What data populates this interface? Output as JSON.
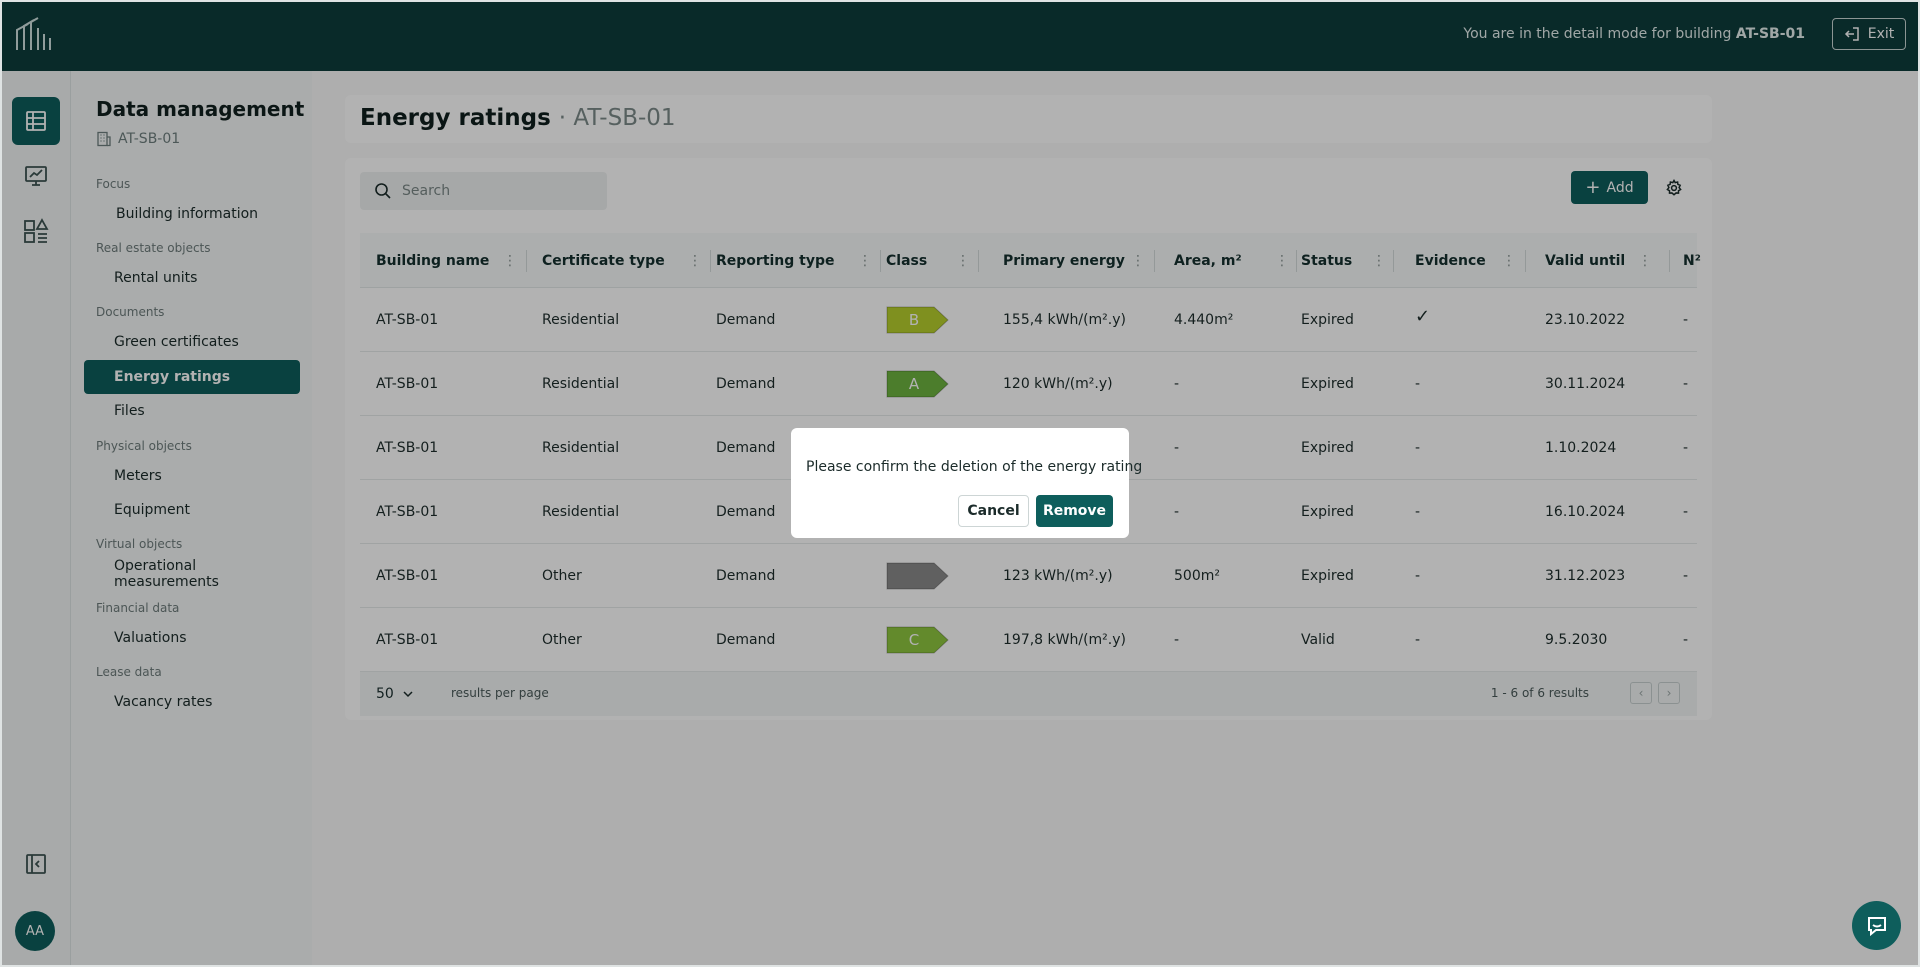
{
  "topbar": {
    "mode_prefix": "You are in the detail mode for building",
    "building": "AT-SB-01",
    "exit_label": "Exit"
  },
  "rail": {
    "items": [
      "table-icon",
      "monitor-chart-icon",
      "widgets-icon"
    ],
    "collapse_icon": "sidebar-collapse-icon",
    "avatar_initials": "AA"
  },
  "sidenav": {
    "title": "Data management",
    "building": "AT-SB-01",
    "sections": [
      {
        "label": "Focus",
        "items": [
          "Building information"
        ]
      },
      {
        "label": "Real estate objects",
        "items": [
          "Rental units"
        ]
      },
      {
        "label": "Documents",
        "items": [
          "Green certificates",
          "Energy ratings",
          "Files"
        ]
      },
      {
        "label": "Physical objects",
        "items": [
          "Meters",
          "Equipment"
        ]
      },
      {
        "label": "Virtual objects",
        "items": [
          "Operational measurements"
        ]
      },
      {
        "label": "Financial data",
        "items": [
          "Valuations"
        ]
      },
      {
        "label": "Lease data",
        "items": [
          "Vacancy rates"
        ]
      }
    ],
    "active_item": "Energy ratings"
  },
  "page": {
    "title": "Energy ratings",
    "subtitle": "· AT-SB-01"
  },
  "toolbar": {
    "search_placeholder": "Search",
    "add_label": "Add"
  },
  "table": {
    "columns": [
      "Building name",
      "Certificate type",
      "Reporting type",
      "Class",
      "Primary energy",
      "Area, m²",
      "Status",
      "Evidence",
      "Valid until",
      "N²"
    ],
    "rows": [
      {
        "building": "AT-SB-01",
        "certificate": "Residential",
        "reporting": "Demand",
        "class": "B",
        "primary": "155,4 kWh/(m².y)",
        "area": "4.440m²",
        "status": "Expired",
        "evidence": "✓",
        "valid": "23.10.2022",
        "extra": "-"
      },
      {
        "building": "AT-SB-01",
        "certificate": "Residential",
        "reporting": "Demand",
        "class": "A",
        "primary": "120 kWh/(m².y)",
        "area": "-",
        "status": "Expired",
        "evidence": "-",
        "valid": "30.11.2024",
        "extra": "-"
      },
      {
        "building": "AT-SB-01",
        "certificate": "Residential",
        "reporting": "Demand",
        "class": "",
        "primary": "",
        "area": "-",
        "status": "Expired",
        "evidence": "-",
        "valid": "1.10.2024",
        "extra": "-"
      },
      {
        "building": "AT-SB-01",
        "certificate": "Residential",
        "reporting": "Demand",
        "class": "",
        "primary": "",
        "area": "-",
        "status": "Expired",
        "evidence": "-",
        "valid": "16.10.2024",
        "extra": "-"
      },
      {
        "building": "AT-SB-01",
        "certificate": "Other",
        "reporting": "Demand",
        "class": "",
        "primary": "123 kWh/(m².y)",
        "area": "500m²",
        "status": "Expired",
        "evidence": "-",
        "valid": "31.12.2023",
        "extra": "-"
      },
      {
        "building": "AT-SB-01",
        "certificate": "Other",
        "reporting": "Demand",
        "class": "C",
        "primary": "197,8 kWh/(m².y)",
        "area": "-",
        "status": "Valid",
        "evidence": "-",
        "valid": "9.5.2030",
        "extra": "-"
      }
    ],
    "class_colors": {
      "A": "#6db33f",
      "B": "#b6cf2d",
      "C": "#8ec63f",
      "": "#8a8a8a"
    }
  },
  "pagination": {
    "per_page": "50",
    "per_page_label": "results per page",
    "results_text": "1 -  6 of  6 results"
  },
  "dialog": {
    "message": "Please confirm the deletion of the energy rating",
    "cancel_label": "Cancel",
    "remove_label": "Remove"
  },
  "colors": {
    "brand_dark": "#0d3d3c",
    "accent": "#0e5e5c"
  }
}
